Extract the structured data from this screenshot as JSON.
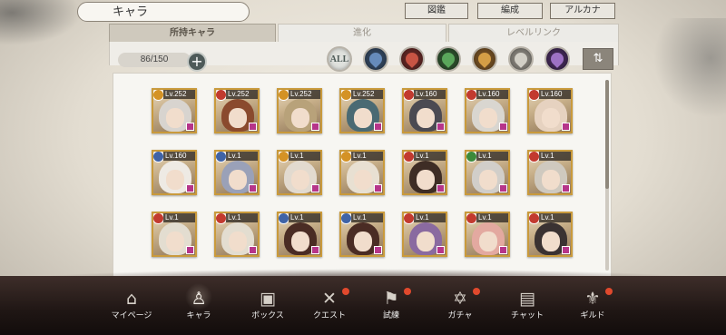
{
  "header": {
    "title": "キャラ",
    "buttons": [
      {
        "label": "図鑑"
      },
      {
        "label": "編成"
      },
      {
        "label": "アルカナ"
      }
    ]
  },
  "tabs": [
    {
      "label": "所持キャラ",
      "active": true
    },
    {
      "label": "進化",
      "active": false
    },
    {
      "label": "レベルリンク",
      "active": false
    }
  ],
  "toolbar": {
    "count": "86/150",
    "plus_icon": "plus-icon",
    "filters": [
      {
        "name": "all",
        "label": "ALL",
        "color": "#dfe1dd"
      },
      {
        "name": "water",
        "color": "#3f5f8e"
      },
      {
        "name": "fire",
        "color": "#b0382f"
      },
      {
        "name": "wind",
        "color": "#3c8a3a"
      },
      {
        "name": "earth",
        "color": "#c7862d"
      },
      {
        "name": "light",
        "color": "#a8a49a"
      },
      {
        "name": "dark",
        "color": "#7a4a9a"
      }
    ],
    "sort_icon": "sort-icon"
  },
  "characters": [
    {
      "level": "Lv.252",
      "element": "#d49225",
      "hair": "#d8d4cf"
    },
    {
      "level": "Lv.252",
      "element": "#c23a2f",
      "hair": "#8a4a2e"
    },
    {
      "level": "Lv.252",
      "element": "#d49225",
      "hair": "#b8a27a"
    },
    {
      "level": "Lv.252",
      "element": "#d49225",
      "hair": "#4a6a73"
    },
    {
      "level": "Lv.160",
      "element": "#c23a2f",
      "hair": "#4b4a52"
    },
    {
      "level": "Lv.160",
      "element": "#c23a2f",
      "hair": "#d9d6d0"
    },
    {
      "level": "Lv.160",
      "element": "#c23a2f",
      "hair": "#e6d2c0"
    },
    {
      "level": "Lv.160",
      "element": "#3f63a6",
      "hair": "#eeeae4"
    },
    {
      "level": "Lv.1",
      "element": "#3f63a6",
      "hair": "#9aa1b8"
    },
    {
      "level": "Lv.1",
      "element": "#d49225",
      "hair": "#e2dacf"
    },
    {
      "level": "Lv.1",
      "element": "#d49225",
      "hair": "#e8e0d2"
    },
    {
      "level": "Lv.1",
      "element": "#c23a2f",
      "hair": "#3e2d25"
    },
    {
      "level": "Lv.1",
      "element": "#3c8a3a",
      "hair": "#d1cec9"
    },
    {
      "level": "Lv.1",
      "element": "#c23a2f",
      "hair": "#cfc9bf"
    },
    {
      "level": "Lv.1",
      "element": "#c23a2f",
      "hair": "#e3ddd0"
    },
    {
      "level": "Lv.1",
      "element": "#c23a2f",
      "hair": "#e3ddd0"
    },
    {
      "level": "Lv.1",
      "element": "#3f63a6",
      "hair": "#4a2c24"
    },
    {
      "level": "Lv.1",
      "element": "#3f63a6",
      "hair": "#4a2c24"
    },
    {
      "level": "Lv.1",
      "element": "#c23a2f",
      "hair": "#8a6aa0"
    },
    {
      "level": "Lv.1",
      "element": "#c23a2f",
      "hair": "#e3a9a0"
    },
    {
      "level": "Lv.1",
      "element": "#c23a2f",
      "hair": "#3a3232"
    }
  ],
  "bottom_nav": [
    {
      "label": "マイページ",
      "icon": "home-icon",
      "glyph": "⌂",
      "active": false,
      "notify": false
    },
    {
      "label": "キャラ",
      "icon": "chara-icon",
      "glyph": "♙",
      "active": true,
      "notify": false
    },
    {
      "label": "ボックス",
      "icon": "box-icon",
      "glyph": "▣",
      "active": false,
      "notify": false
    },
    {
      "label": "クエスト",
      "icon": "swords-icon",
      "glyph": "✕",
      "active": false,
      "notify": true
    },
    {
      "label": "試練",
      "icon": "flag-icon",
      "glyph": "⚑",
      "active": false,
      "notify": true
    },
    {
      "label": "ガチャ",
      "icon": "gacha-icon",
      "glyph": "✡",
      "active": false,
      "notify": true
    },
    {
      "label": "チャット",
      "icon": "chat-icon",
      "glyph": "▤",
      "active": false,
      "notify": false
    },
    {
      "label": "ギルド",
      "icon": "guild-icon",
      "glyph": "⚜",
      "active": false,
      "notify": true
    }
  ]
}
